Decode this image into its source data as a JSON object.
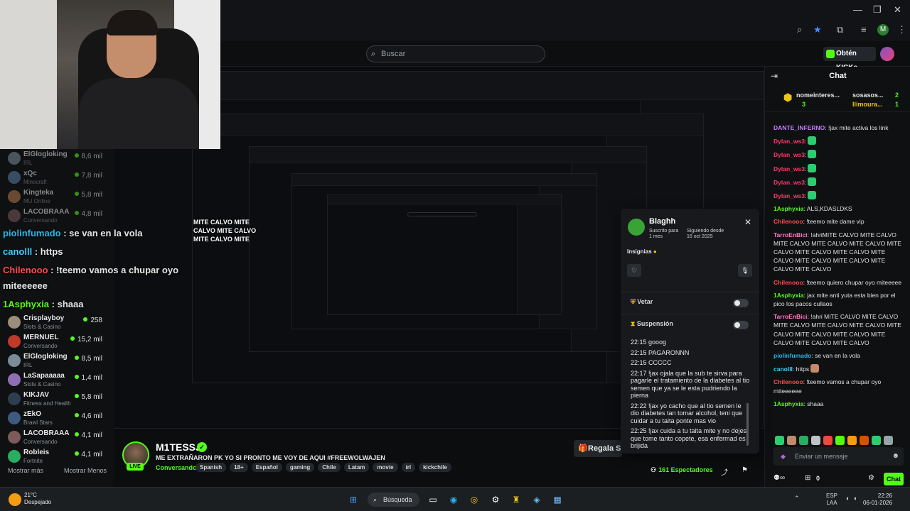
{
  "browser": {
    "search_placeholder": "Buscar",
    "kicks_label": "Obtén KICKs",
    "profile_initial": "M"
  },
  "sidebar": {
    "items": [
      {
        "name": "ElGlogloking",
        "category": "IRL",
        "viewers": "8,6 mil",
        "color": "#7a8c99"
      },
      {
        "name": "xQc",
        "category": "Minecraft",
        "viewers": "7,8 mil",
        "color": "#5a7fa6"
      },
      {
        "name": "Kingteka",
        "category": "MU Online",
        "viewers": "5,8 mil",
        "color": "#b07a4a"
      },
      {
        "name": "LACOBRAAA",
        "category": "Conversando",
        "viewers": "4,8 mil",
        "color": "#7e5a5a"
      },
      {
        "name": "Crisplayboy",
        "category": "Slots & Casino",
        "viewers": "258",
        "color": "#9a8f7a"
      },
      {
        "name": "MERNUEL",
        "category": "Conversando",
        "viewers": "15,2 mil",
        "color": "#c0392b"
      },
      {
        "name": "ElGlogloking",
        "category": "IRL",
        "viewers": "8,5 mil",
        "color": "#7a8c99"
      },
      {
        "name": "LaSapaaaaa",
        "category": "Slots & Casino",
        "viewers": "1,4 mil",
        "color": "#8e6fb3"
      },
      {
        "name": "KIKJAV",
        "category": "Fitness and Health",
        "viewers": "5,8 mil",
        "color": "#2c3e50"
      },
      {
        "name": "zEkO",
        "category": "Brawl Stars",
        "viewers": "4,6 mil",
        "color": "#3d5a80"
      },
      {
        "name": "LACOBRAAA",
        "category": "Conversando",
        "viewers": "4,1 mil",
        "color": "#7e5a5a"
      },
      {
        "name": "Robleis",
        "category": "Fortnite",
        "viewers": "4,1 mil",
        "color": "#27ae60"
      }
    ],
    "show_more": "Mostrar más",
    "show_less": "Mostrar Menos"
  },
  "overlay_chat": [
    {
      "user": "piolinfumado",
      "text": " : se van en la vola",
      "color": "#2bb5e8"
    },
    {
      "user": "canolll",
      "text": " : https",
      "color": "#3fd1ff"
    },
    {
      "user": "Chilenooo",
      "text": " : !teemo vamos a chupar oyo",
      "color": "#ff4d4d"
    },
    {
      "user": "",
      "text": "miteeeeee",
      "color": "#ffffff"
    },
    {
      "user": "1Asphyxia",
      "text": " : shaaa",
      "color": "#53fc18"
    }
  ],
  "stream": {
    "streamer": "M1TESSJ",
    "live": "LIVE",
    "title": "ME EXTRAÑARON PK YO SI PRONTO ME VOY DE AQUI #FREEWOLWAJEN",
    "category": "Conversando",
    "tags": [
      "Spanish",
      "18+",
      "Español",
      "gaming",
      "Chile",
      "Latam",
      "movie",
      "irl",
      "kickchile"
    ],
    "gift_label": "Regala S",
    "viewers_label": "161 Espectadores"
  },
  "popup": {
    "username": "Blaghh",
    "sub_label": "Suscrito para",
    "sub_value": "1 mes",
    "follow_label": "Siguiendo desde",
    "follow_value": "16 oct 2025",
    "badges_label": "Insignias",
    "ban_label": "Vetar",
    "suspend_label": "Suspensión",
    "log": [
      "22:15 gooog",
      "22:15 PAGARONNN",
      "22:15 CCCCC",
      "22:17 !jax ojala que la sub te sirva para pagarle el tratamiento de la diabetes al tio semen que ya se le esta pudriendo la pierna",
      "22:22 !jax yo cacho que al tio semen le dio diabetes tan tomar alcohol, teni que cuidar a tu taita ponte mas vio",
      "22:25 !jax cuida a tu taita mite y no dejes que tome tanto copete, esa enfermad es brijida"
    ]
  },
  "chat": {
    "title": "Chat",
    "gifters": [
      {
        "name": "nomeinteres...",
        "count": "3"
      },
      {
        "name": "sosasos...",
        "count": "2"
      },
      {
        "name": "llimoura...",
        "count": "1"
      }
    ],
    "messages": [
      {
        "user": "DANTE_INFERNO",
        "text": ": !jax mite activa los link",
        "color": "#c77dff"
      },
      {
        "user": "Dylan_ws3",
        "text": ":",
        "color": "#ff3b6b"
      },
      {
        "user": "Dylan_ws3",
        "text": ":",
        "color": "#ff3b6b"
      },
      {
        "user": "Dylan_ws3",
        "text": ":",
        "color": "#ff3b6b"
      },
      {
        "user": "Dylan_ws3",
        "text": ":",
        "color": "#ff3b6b"
      },
      {
        "user": "Dylan_ws3",
        "text": ":",
        "color": "#ff3b6b"
      },
      {
        "user": "1Asphyxia",
        "text": ": ALS,KDASLDKS",
        "color": "#53fc18"
      },
      {
        "user": "Chilenooo",
        "text": ": !teemo mite dame vip",
        "color": "#ff4d4d"
      },
      {
        "user": "TarroEnBici",
        "text": ": !ahriMITE CALVO MITE CALVO MITE CALVO MITE CALVO MITE CALVO MITE CALVO MITE CALVO MITE CALVO MITE CALVO MITE CALVO MITE CALVO MITE CALVO MITE CALVO",
        "color": "#ff79c6"
      },
      {
        "user": "Chilenooo",
        "text": ": !teemo quiero chupar oyo miteeeee",
        "color": "#ff4d4d"
      },
      {
        "user": "1Asphyxia",
        "text": ": jax mite anti yuta esta bien por el pico los pacos cullaos",
        "color": "#53fc18"
      },
      {
        "user": "TarroEnBici",
        "text": ": !ahri MITE CALVO MITE CALVO MITE CALVO MITE CALVO MITE CALVO MITE CALVO MITE CALVO MITE CALVO MITE CALVO MITE CALVO MITE CALVO",
        "color": "#ff79c6"
      },
      {
        "user": "piolinfumado",
        "text": ": se van en la vola",
        "color": "#2bb5e8"
      },
      {
        "user": "canolll",
        "text": ": https",
        "color": "#3fd1ff"
      },
      {
        "user": "Chilenooo",
        "text": ": !teemo vamos a chupar oyo miteeeeee",
        "color": "#ff4d4d"
      },
      {
        "user": "1Asphyxia",
        "text": ": shaaa",
        "color": "#53fc18"
      }
    ],
    "input_placeholder": "Enviar un mensaje",
    "points": "0",
    "send_label": "Chat"
  },
  "recursion_ghost": [
    "MITE CALVO MITE",
    "CALVO MITE CALVO",
    "MITE CALVO MITE"
  ],
  "taskbar": {
    "temp": "21°C",
    "weather": "Despejado",
    "search_label": "Búsqueda",
    "lang": "ESP",
    "lang_sub": "LAA",
    "time": "22:26",
    "date": "06-01-2026"
  }
}
